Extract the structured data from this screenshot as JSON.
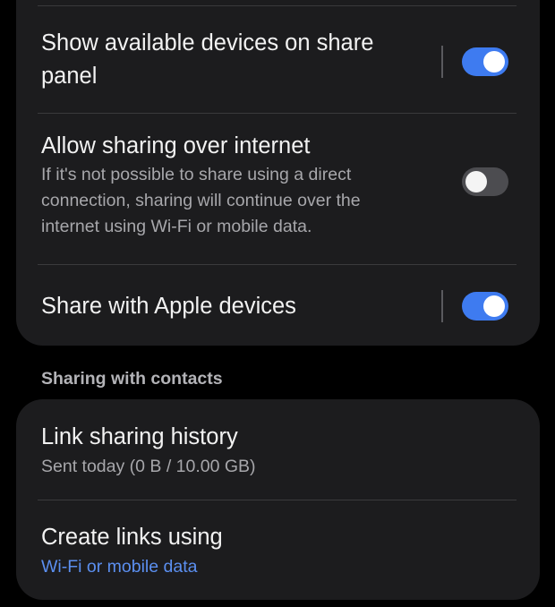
{
  "main_card": {
    "items": [
      {
        "title_line1": "Show available devices on share",
        "title_line2": "panel",
        "toggle_state": "on"
      },
      {
        "title": "Allow sharing over internet",
        "description_lines": [
          "If it's not possible to share using a direct",
          "connection, sharing will continue over the",
          "internet using Wi-Fi or mobile data."
        ],
        "toggle_state": "off"
      },
      {
        "title": "Share with Apple devices",
        "toggle_state": "on"
      }
    ]
  },
  "contacts_section": {
    "header": "Sharing with contacts",
    "items": [
      {
        "title": "Link sharing history",
        "subtitle": "Sent today (0 B / 10.00 GB)"
      },
      {
        "title": "Create links using",
        "subtitle": "Wi-Fi or mobile data"
      }
    ]
  },
  "colors": {
    "background": "#000000",
    "card": "#1c1c1e",
    "toggle_on": "#3e7bf0",
    "toggle_off": "#4c4c50",
    "accent_text": "#5b8ff0",
    "secondary_text": "#a7a7ab"
  }
}
